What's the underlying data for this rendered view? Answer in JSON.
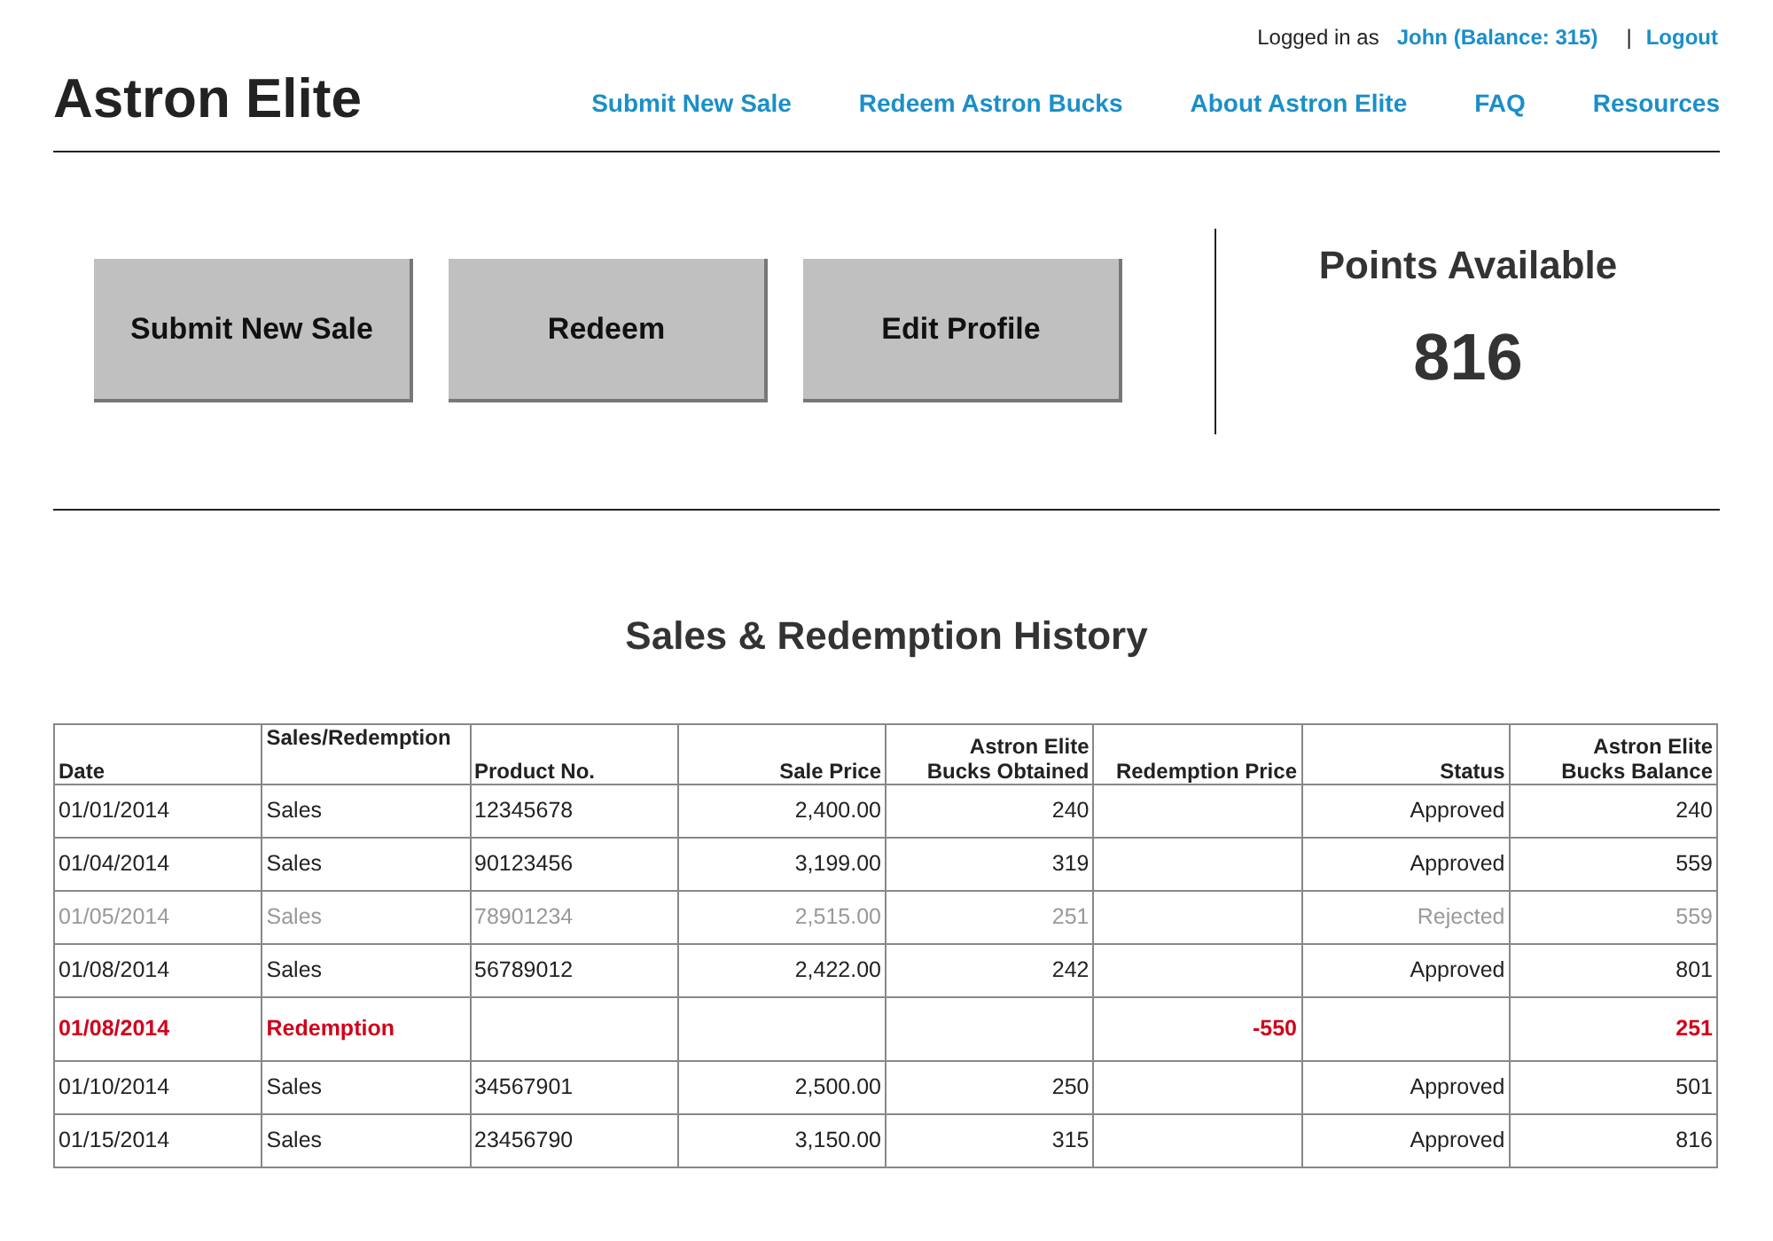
{
  "user_bar": {
    "logged_in_label": "Logged in as",
    "user": "John (Balance: 315)",
    "separator": "|",
    "logout": "Logout"
  },
  "brand": "Astron Elite",
  "nav": [
    "Submit New Sale",
    "Redeem Astron Bucks",
    "About Astron Elite",
    "FAQ",
    "Resources"
  ],
  "actions": [
    "Submit New Sale",
    "Redeem",
    "Edit Profile"
  ],
  "points": {
    "label": "Points Available",
    "value": "816"
  },
  "history": {
    "title": "Sales & Redemption History",
    "columns": [
      "Date",
      "Sales/Redemption",
      "Product No.",
      "Sale Price",
      "Astron Elite\nBucks Obtained",
      "Redemption Price",
      "Status",
      "Astron Elite\nBucks Balance"
    ],
    "rows": [
      {
        "kind": "sale",
        "disabled": false,
        "cells": [
          "01/01/2014",
          "Sales",
          "12345678",
          "2,400.00",
          "240",
          "",
          "Approved",
          "240"
        ]
      },
      {
        "kind": "sale",
        "disabled": false,
        "cells": [
          "01/04/2014",
          "Sales",
          "90123456",
          "3,199.00",
          "319",
          "",
          "Approved",
          "559"
        ]
      },
      {
        "kind": "sale",
        "disabled": true,
        "cells": [
          "01/05/2014",
          "Sales",
          "78901234",
          "2,515.00",
          "251",
          "",
          "Rejected",
          "559"
        ]
      },
      {
        "kind": "sale",
        "disabled": false,
        "cells": [
          "01/08/2014",
          "Sales",
          "56789012",
          "2,422.00",
          "242",
          "",
          "Approved",
          "801"
        ]
      },
      {
        "kind": "redemption",
        "disabled": false,
        "cells": [
          "01/08/2014",
          "Redemption",
          "",
          "",
          "",
          "-550",
          "",
          "251"
        ]
      },
      {
        "kind": "sale",
        "disabled": false,
        "cells": [
          "01/10/2014",
          "Sales",
          "34567901",
          "2,500.00",
          "250",
          "",
          "Approved",
          "501"
        ]
      },
      {
        "kind": "sale",
        "disabled": false,
        "cells": [
          "01/15/2014",
          "Sales",
          "23456790",
          "3,150.00",
          "315",
          "",
          "Approved",
          "816"
        ]
      }
    ]
  }
}
